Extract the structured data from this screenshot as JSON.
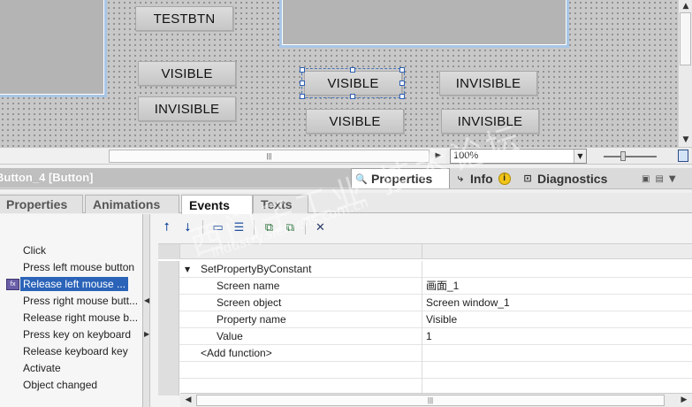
{
  "canvas": {
    "buttons": {
      "testbtn": "TESTBTN",
      "visible_1": "VISIBLE",
      "invisible_1": "INVISIBLE",
      "visible_2": "VISIBLE",
      "visible_3": "VISIBLE",
      "invisible_2": "INVISIBLE",
      "invisible_3": "INVISIBLE"
    },
    "zoom": "100%"
  },
  "inspector": {
    "object_title": "Button_4 [Button]",
    "top_tabs": {
      "properties": "Properties",
      "info": "Info",
      "diagnostics": "Diagnostics"
    },
    "sub_tabs": [
      "Properties",
      "Animations",
      "Events",
      "Texts"
    ],
    "active_sub_tab": "Events"
  },
  "events": [
    "Click",
    "Press left mouse button",
    "Release left mouse ...",
    "Press right mouse butt...",
    "Release right mouse b...",
    "Press key on keyboard",
    "Release keyboard key",
    "Activate",
    "Object changed"
  ],
  "selected_event": "Release left mouse ...",
  "function_list": {
    "function_name": "SetPropertyByConstant",
    "params": [
      {
        "name": "Screen name",
        "value": "画面_1"
      },
      {
        "name": "Screen object",
        "value": "Screen window_1"
      },
      {
        "name": "Property name",
        "value": "Visible"
      },
      {
        "name": "Value",
        "value": "1"
      }
    ],
    "add_function": "<Add function>"
  },
  "watermark": {
    "text": "西门子工业 技术论坛",
    "url": "industry.siemens.com.cn"
  },
  "colors": {
    "accent": "#2a63b8",
    "screen_window_border": "#a9c6e6",
    "event_icon": "#6b5ea8"
  }
}
